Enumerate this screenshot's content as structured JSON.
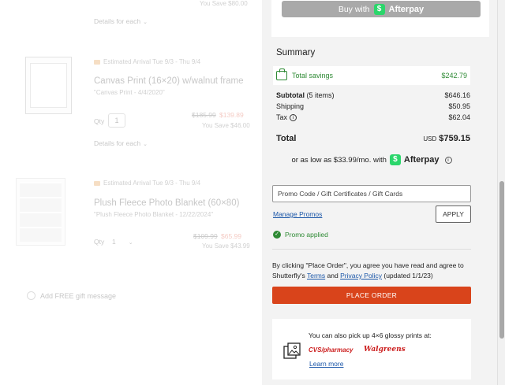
{
  "cart": {
    "top_you_save": "You Save $80.00",
    "items": [
      {
        "details_label": "Details for each",
        "delivery": "Estimated Arrival Tue 9/3 - Thu 9/4",
        "title": "Canvas Print (16×20) w/walnut frame",
        "subtitle": "\"Canvas Print - 4/4/2020\"",
        "qty_label": "Qty",
        "qty_value": "1",
        "orig_price": "$185.99",
        "sale_price": "$139.89",
        "you_save": "You Save $46.00"
      },
      {
        "details_label": "Details for each",
        "delivery": "Estimated Arrival Tue 9/3 - Thu 9/4",
        "title": "Plush Fleece Photo Blanket (60×80)",
        "subtitle": "\"Plush Fleece Photo Blanket - 12/22/2024\"",
        "qty_label": "Qty",
        "qty_value": "1",
        "orig_price": "$109.99",
        "sale_price": "$65.99",
        "you_save": "You Save $43.99"
      }
    ],
    "gift_message_label": "Add FREE gift message"
  },
  "afterpay_button": {
    "prefix": "Buy with",
    "brand": "Afterpay",
    "logo_glyph": "$"
  },
  "summary": {
    "title": "Summary",
    "total_savings_label": "Total savings",
    "total_savings_value": "$242.79",
    "subtotal_label": "Subtotal",
    "subtotal_items": "(5 items)",
    "subtotal_value": "$646.16",
    "shipping_label": "Shipping",
    "shipping_value": "$50.95",
    "tax_label": "Tax",
    "tax_value": "$62.04",
    "total_label": "Total",
    "total_currency": "USD",
    "total_value": "$759.15",
    "installment_text": "or as low as $33.99/mo. with",
    "installment_brand": "Afterpay"
  },
  "promo": {
    "placeholder": "Promo Code / Gift Certificates / Gift Cards",
    "manage_label": "Manage Promos",
    "apply_label": "APPLY",
    "applied_label": "Promo applied"
  },
  "terms": {
    "prefix": "By clicking \"Place Order\", you agree you have read and agree to Shutterfly's",
    "terms_link": "Terms",
    "and": "and",
    "privacy_link": "Privacy Policy",
    "suffix": "(updated 1/1/23)"
  },
  "place_order_label": "PLACE ORDER",
  "pickup": {
    "text": "You can also pick up 4×6 glossy prints at:",
    "cvs_label": "CVS/pharmacy",
    "walgreens_label": "Walgreens",
    "learn_more": "Learn more"
  },
  "colors": {
    "accent_orange": "#d9441b",
    "savings_green": "#2e8a34",
    "link_blue": "#1a56a8",
    "afterpay_mint": "#b2fce4"
  }
}
